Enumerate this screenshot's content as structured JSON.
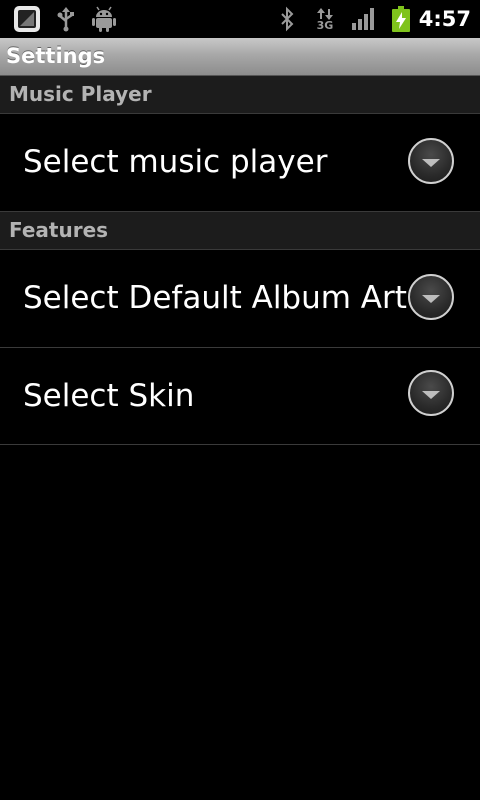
{
  "status_bar": {
    "time": "4:57",
    "network_label": "3G",
    "icons": [
      "app-notification-icon",
      "usb-icon",
      "android-debug-icon",
      "bluetooth-icon",
      "network-3g-icon",
      "signal-icon",
      "battery-charging-icon"
    ]
  },
  "title_bar": {
    "title": "Settings"
  },
  "sections": [
    {
      "header": "Music Player",
      "items": [
        {
          "label": "Select music player"
        }
      ]
    },
    {
      "header": "Features",
      "items": [
        {
          "label": "Select Default Album Art"
        },
        {
          "label": "Select Skin"
        }
      ]
    }
  ],
  "colors": {
    "background": "#000000",
    "section_header_bg": "#1c1c1c",
    "section_header_text": "#b3b3b3",
    "divider": "#3a3a3a",
    "battery_green": "#7fc31c"
  }
}
